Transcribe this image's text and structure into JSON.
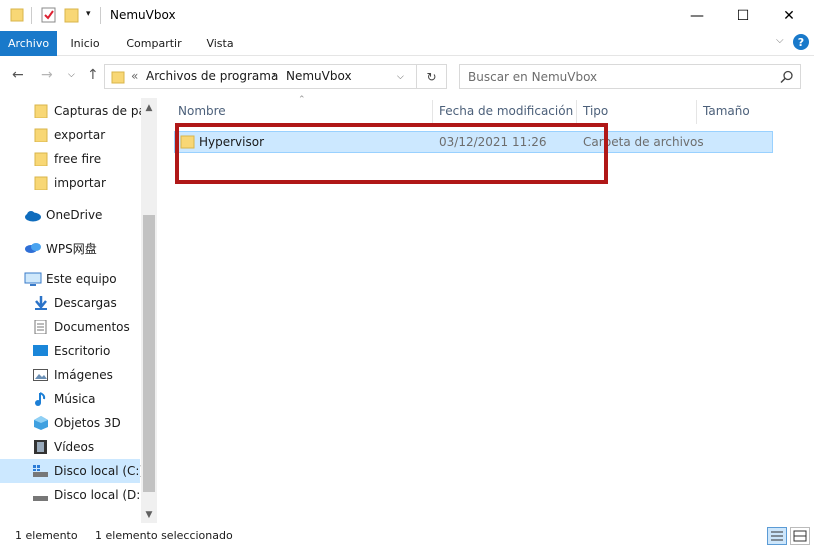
{
  "window": {
    "title": "NemuVbox",
    "minimize": "—",
    "maximize": "☐",
    "close": "✕"
  },
  "ribbon": {
    "tabs": [
      "Archivo",
      "Inicio",
      "Compartir",
      "Vista"
    ]
  },
  "address": {
    "overflow": "«",
    "crumbs": [
      "Archivos de programa",
      "NemuVbox"
    ],
    "search_placeholder": "Buscar en NemuVbox"
  },
  "nav": {
    "items": [
      {
        "label": "Capturas de pan",
        "icon": "folder-icon"
      },
      {
        "label": "exportar",
        "icon": "folder-icon"
      },
      {
        "label": "free fire",
        "icon": "folder-icon"
      },
      {
        "label": "importar",
        "icon": "folder-icon"
      },
      {
        "label": "OneDrive",
        "icon": "cloud-icon"
      },
      {
        "label": "WPS网盘",
        "icon": "wps-cloud-icon"
      },
      {
        "label": "Este equipo",
        "icon": "computer-icon"
      },
      {
        "label": "Descargas",
        "icon": "download-icon"
      },
      {
        "label": "Documentos",
        "icon": "document-icon"
      },
      {
        "label": "Escritorio",
        "icon": "desktop-icon"
      },
      {
        "label": "Imágenes",
        "icon": "pictures-icon"
      },
      {
        "label": "Música",
        "icon": "music-icon"
      },
      {
        "label": "Objetos 3D",
        "icon": "3d-objects-icon"
      },
      {
        "label": "Vídeos",
        "icon": "videos-icon"
      },
      {
        "label": "Disco local (C:)",
        "icon": "drive-icon",
        "selected": true
      },
      {
        "label": "Disco local (D:)",
        "icon": "drive-icon"
      }
    ]
  },
  "columns": [
    "Nombre",
    "Fecha de modificación",
    "Tipo",
    "Tamaño"
  ],
  "files": [
    {
      "name": "Hypervisor",
      "modified": "03/12/2021 11:26",
      "type": "Carpeta de archivos",
      "size": ""
    }
  ],
  "status": {
    "count": "1 elemento",
    "selected": "1 elemento seleccionado"
  },
  "colors": {
    "accent": "#1979ca",
    "selection": "#cce8ff",
    "highlight_box": "#b01818",
    "folder": "#f8d775"
  }
}
